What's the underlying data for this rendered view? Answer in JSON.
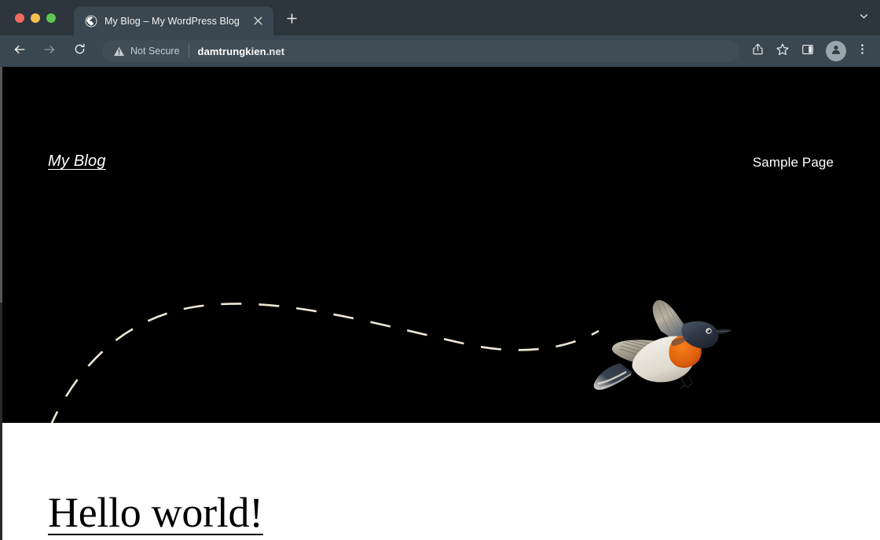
{
  "browser": {
    "window_controls": [
      {
        "name": "close",
        "color": "#ed6a5e"
      },
      {
        "name": "minimize",
        "color": "#f4bd4f"
      },
      {
        "name": "maximize",
        "color": "#61c554"
      }
    ],
    "tab": {
      "title": "My Blog – My WordPress Blog",
      "favicon": "globe-icon",
      "close_label": "Close tab"
    },
    "new_tab_label": "New Tab",
    "tab_search_label": "Search tabs",
    "toolbar": {
      "back_label": "Back",
      "forward_label": "Forward",
      "reload_label": "Reload",
      "security_status": "Not Secure",
      "url_main": "damtrungkien",
      "url_tld": ".net",
      "share_label": "Share",
      "bookmark_label": "Bookmark this tab",
      "side_panel_label": "Side panel",
      "profile_label": "Profile",
      "menu_label": "Customize and control Google Chrome"
    },
    "colors": {
      "tabstrip_bg": "#2c363c",
      "toolbar_bg": "#3a4750",
      "active_tab_bg": "#3a4750",
      "omnibox_bg": "#404d57",
      "chrome_text": "#f1f3f4"
    }
  },
  "page": {
    "site_title": "My Blog",
    "nav": [
      {
        "label": "Sample Page",
        "href": "#"
      }
    ],
    "hero": {
      "background_color": "#000000",
      "flight_path_color": "#eee7d4",
      "bird_alt": "flying bird illustration"
    },
    "post": {
      "title": "Hello world!"
    },
    "colors": {
      "hero_bg": "#000000",
      "content_bg": "#ffffff",
      "text_on_dark": "#ffffff",
      "text_on_light": "#000000"
    }
  }
}
